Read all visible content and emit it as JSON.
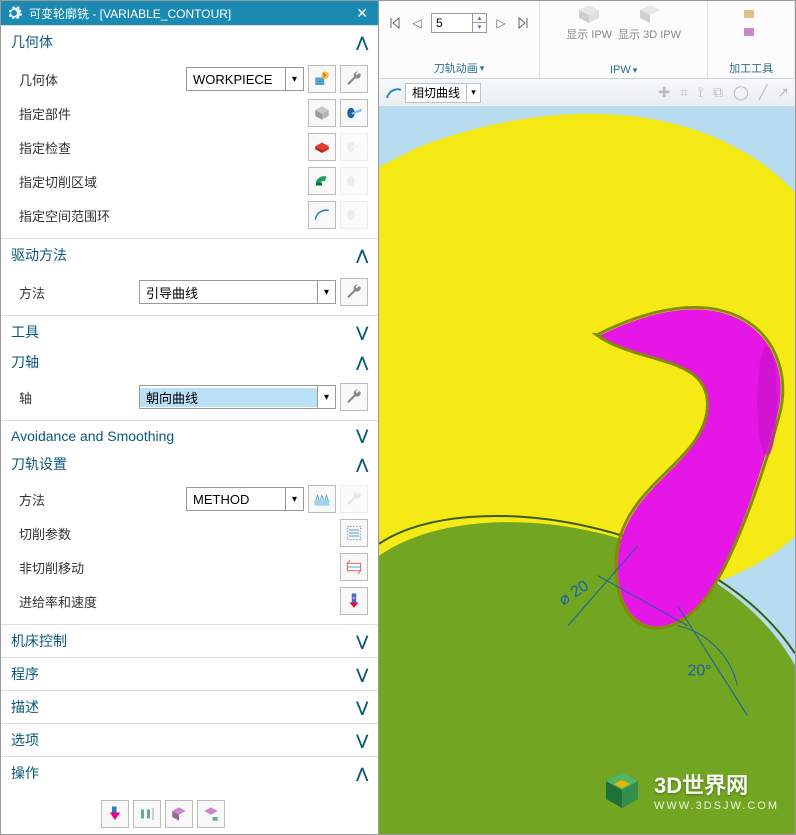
{
  "titlebar": {
    "title": "可变轮廓铣 - [VARIABLE_CONTOUR]"
  },
  "ribbon": {
    "display_ipw": "显示 IPW",
    "display_3d_ipw": "显示 3D IPW",
    "spinner_value": "5",
    "group_toolpath": "刀轨动画",
    "group_ipw": "IPW",
    "group_tool": "加工工具"
  },
  "toolbar2": {
    "dropdown": "相切曲线"
  },
  "sections": {
    "geom": {
      "header": "几何体",
      "body_label": "几何体",
      "body_value": "WORKPIECE",
      "spec_part": "指定部件",
      "spec_check": "指定检查",
      "spec_cutarea": "指定切削区域",
      "spec_spacerange": "指定空间范围环"
    },
    "drive": {
      "header": "驱动方法",
      "method_label": "方法",
      "method_value": "引导曲线"
    },
    "tool": {
      "header": "工具"
    },
    "axis": {
      "header": "刀轴",
      "axis_label": "轴",
      "axis_value": "朝向曲线"
    },
    "avoid": {
      "header": "Avoidance and Smoothing"
    },
    "path": {
      "header": "刀轨设置",
      "method_label": "方法",
      "method_value": "METHOD",
      "cut_params": "切削参数",
      "noncut": "非切削移动",
      "feed": "进给率和速度"
    },
    "machine": {
      "header": "机床控制"
    },
    "program": {
      "header": "程序"
    },
    "desc": {
      "header": "描述"
    },
    "options": {
      "header": "选项"
    },
    "ops": {
      "header": "操作"
    }
  },
  "scene": {
    "dim_diameter": "⌀ 20",
    "dim_angle": "20°"
  },
  "watermark": {
    "line1": "3D世界网",
    "line2": "WWW.3DSJW.COM"
  }
}
